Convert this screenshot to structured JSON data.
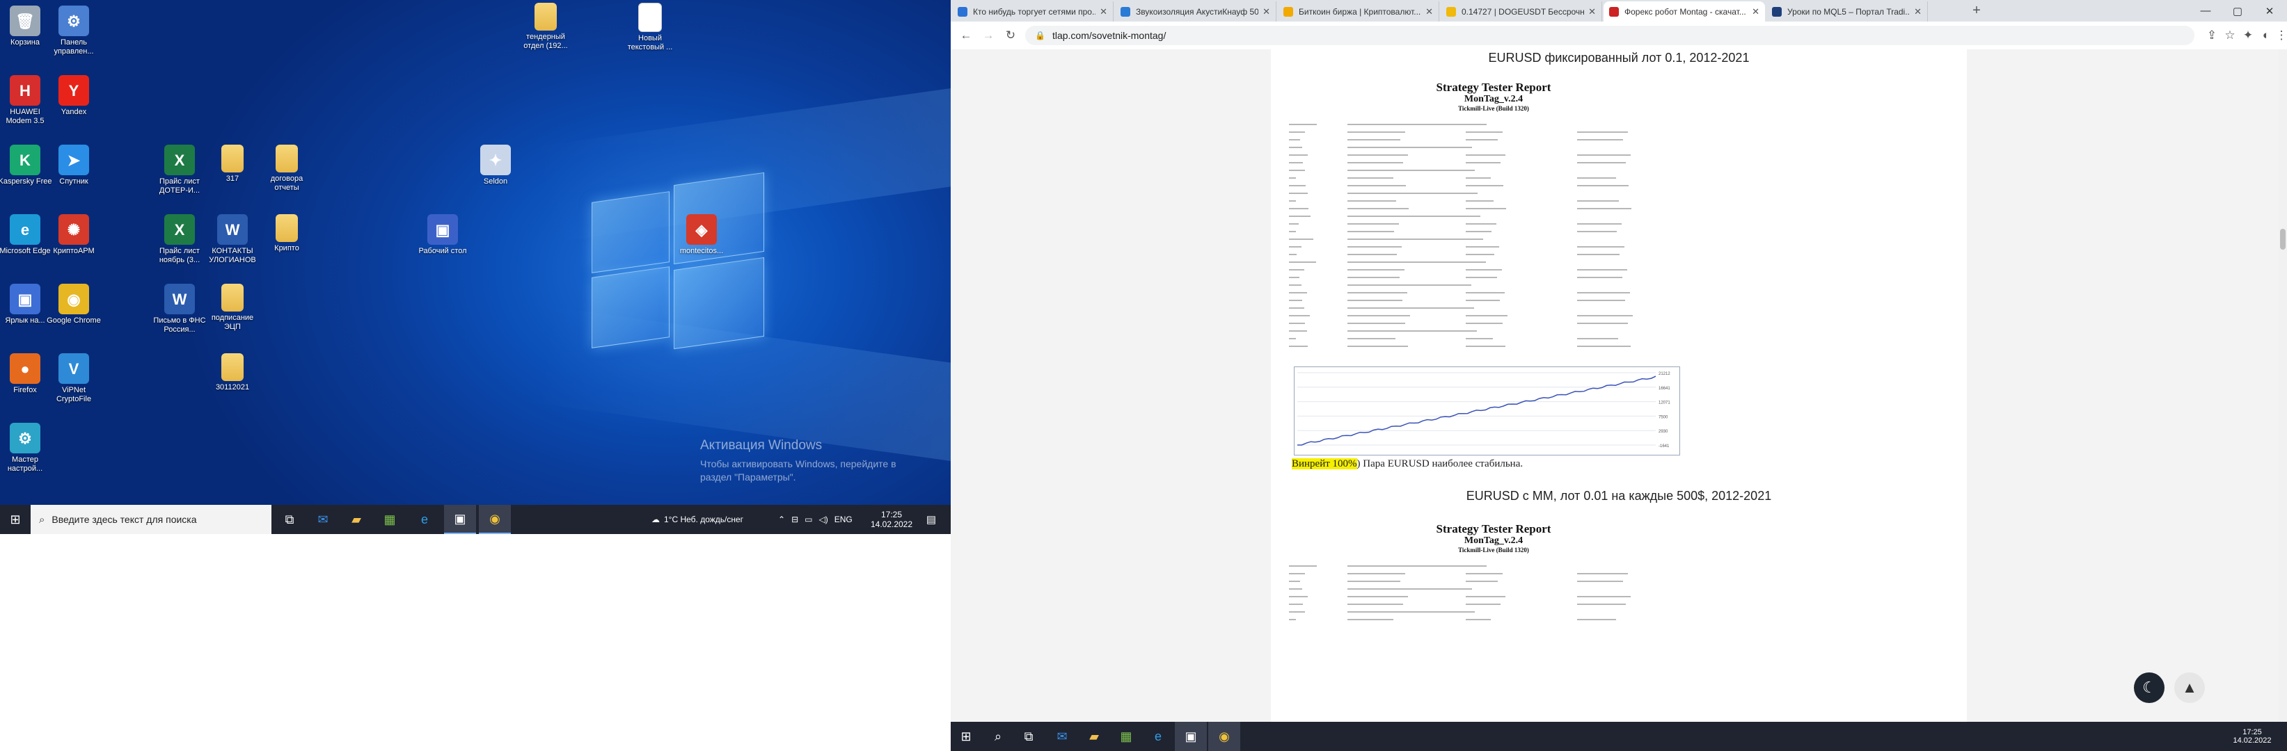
{
  "desktop": {
    "icons": [
      {
        "label": "Корзина",
        "glyph": "🗑",
        "color": "#9aa7b5"
      },
      {
        "label": "Панель управлен...",
        "glyph": "⚙",
        "color": "#4a7fd1"
      },
      {
        "label": "HUAWEI Modem 3.5",
        "glyph": "H",
        "color": "#d62d2d"
      },
      {
        "label": "Yandex",
        "glyph": "Y",
        "color": "#e8241a"
      },
      {
        "label": "Kaspersky Free",
        "glyph": "K",
        "color": "#19a870"
      },
      {
        "label": "Спутник",
        "glyph": "➤",
        "color": "#2a8ee6"
      },
      {
        "label": "Microsoft Edge",
        "glyph": "e",
        "color": "#1c9ad6"
      },
      {
        "label": "КриптоАРМ",
        "glyph": "✺",
        "color": "#d63a2a"
      },
      {
        "label": "Ярлык на...",
        "glyph": "▣",
        "color": "#3c6ed6"
      },
      {
        "label": "Google Chrome",
        "glyph": "◉",
        "color": "#e6b722"
      },
      {
        "label": "Firefox",
        "glyph": "●",
        "color": "#e66a1e"
      },
      {
        "label": "ViPNet CryptoFile",
        "glyph": "V",
        "color": "#2e8ad6"
      },
      {
        "label": "Мастер настрой...",
        "glyph": "⚙",
        "color": "#2ba4c7"
      },
      {
        "label": "Прайс лист ДОТЕР-И...",
        "glyph": "X",
        "color": "#1e7b45"
      },
      {
        "label": "317",
        "glyph": "",
        "color": "folder"
      },
      {
        "label": "договора отчеты",
        "glyph": "",
        "color": "folder"
      },
      {
        "label": "Прайс лист ноябрь (3...",
        "glyph": "X",
        "color": "#1e7b45"
      },
      {
        "label": "КОНТАКТЫ УЛОГИАНОВ",
        "glyph": "W",
        "color": "#2b5cae"
      },
      {
        "label": "Крипто",
        "glyph": "",
        "color": "folder"
      },
      {
        "label": "Письмо в ФНС Россия...",
        "glyph": "W",
        "color": "#2b5cae"
      },
      {
        "label": "подписание ЭЦП",
        "glyph": "",
        "color": "folder"
      },
      {
        "label": "30112021",
        "glyph": "",
        "color": "folder"
      },
      {
        "label": "тендерный отдел (192...",
        "glyph": "",
        "color": "folder"
      },
      {
        "label": "Новый текстовый ...",
        "glyph": "",
        "color": "doc"
      },
      {
        "label": "Seldon",
        "glyph": "✦",
        "color": "#c9d6ea"
      },
      {
        "label": "Рабочий стол",
        "glyph": "▣",
        "color": "#3b61c9"
      },
      {
        "label": "montecitos...",
        "glyph": "◈",
        "color": "#d63a2a"
      }
    ],
    "activation_title": "Активация Windows",
    "activation_text": "Чтобы активировать Windows, перейдите в раздел \"Параметры\"."
  },
  "taskbar_left": {
    "search_placeholder": "Введите здесь текст для поиска",
    "weather": "1°C  Неб. дождь/снег",
    "lang": "ENG",
    "time": "17:25",
    "date": "14.02.2022"
  },
  "browser": {
    "tabs": [
      {
        "title": "Кто нибудь торгует сетями про...",
        "color": "#2a72d6"
      },
      {
        "title": "Звукоизоляция АкустиКнауф 50...",
        "color": "#2a7bd6"
      },
      {
        "title": "Биткоин биржа | Криптовалют...",
        "color": "#f2a900"
      },
      {
        "title": "0.14727 | DOGEUSDT Бессрочн...",
        "color": "#f0b90b"
      },
      {
        "title": "Форекс робот Montag - скачат...",
        "color": "#cc2222"
      },
      {
        "title": "Уроки по MQL5 – Портал Tradi...",
        "color": "#1f3f7a"
      }
    ],
    "url": "tlap.com/sovetnik-montag/",
    "page": {
      "heading1": "EURUSD фиксированный лот 0.1, 2012-2021",
      "report_title": "Strategy Tester Report",
      "report_ea": "MonTag_v.2.4",
      "report_build": "Tickmill-Live (Build 1320)",
      "winrate_label": "Винрейт 100%",
      "winrate_rest": ") Пара EURUSD наиболее стабильна.",
      "heading2": "EURUSD с ММ, лот 0.01 на каждые 500$, 2012-2021",
      "chart_axis_labels": [
        "21212",
        "16641",
        "12071",
        "7500",
        "2930",
        "-1641"
      ]
    }
  },
  "taskbar_right": {
    "time": "17:25",
    "date": "14.02.2022"
  },
  "colors": {
    "accent": "#0a3c9a",
    "taskbar": "#1f2430",
    "highlight": "#f6f000",
    "chart_line": "#3a53b8"
  }
}
